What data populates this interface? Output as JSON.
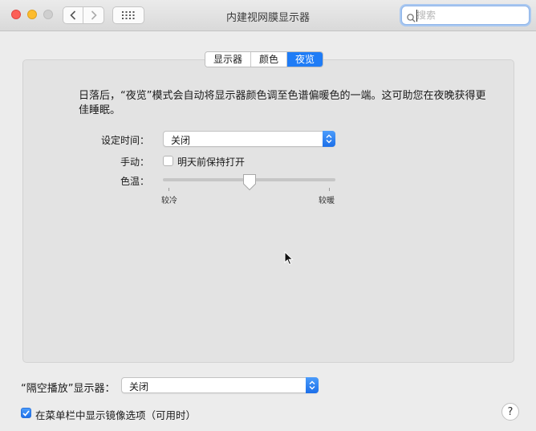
{
  "window": {
    "title": "内建视网膜显示器"
  },
  "search": {
    "placeholder": "搜索"
  },
  "tabs": [
    {
      "label": "显示器",
      "active": false
    },
    {
      "label": "颜色",
      "active": false
    },
    {
      "label": "夜览",
      "active": true
    }
  ],
  "night_shift": {
    "description": "日落后，“夜览”模式会自动将显示器颜色调至色谱偏暖色的一端。这可助您在夜晚获得更佳睡眠。",
    "schedule": {
      "label": "设定时间：",
      "value": "关闭"
    },
    "manual": {
      "label": "手动：",
      "checkbox_label": "明天前保持打开",
      "checked": false
    },
    "color_temp": {
      "label": "色温：",
      "min_label": "较冷",
      "max_label": "较暖",
      "value_fraction": 0.5
    }
  },
  "airplay": {
    "label": "“隔空播放”显示器：",
    "value": "关闭"
  },
  "mirroring": {
    "label": "在菜单栏中显示镜像选项（可用时）",
    "checked": true
  },
  "help": {
    "label": "?"
  },
  "colors": {
    "accent": "#1f7cf6",
    "window_bg": "#ececec",
    "panel_bg": "#e3e3e3"
  }
}
